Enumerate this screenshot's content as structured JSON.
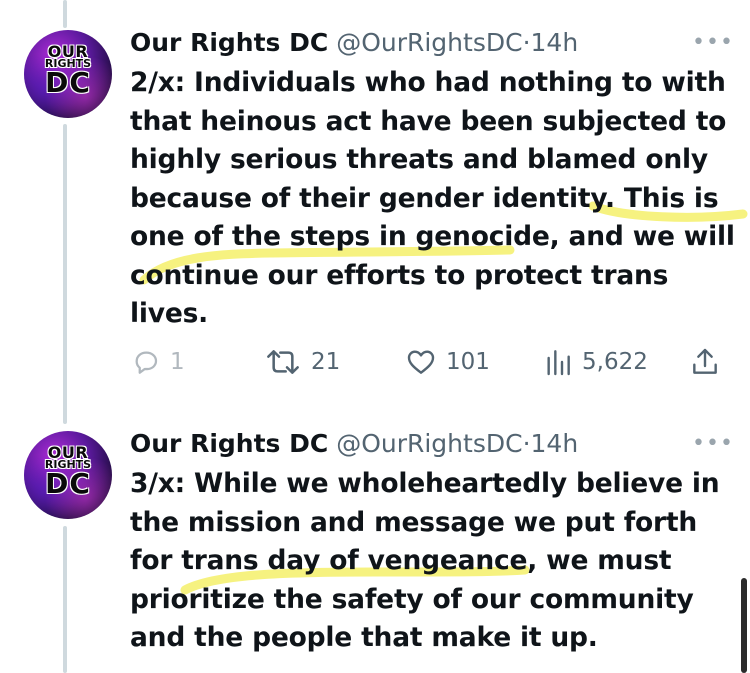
{
  "tweets": [
    {
      "avatar": {
        "line1": "OUR",
        "line2": "RIGHTS",
        "line3": "DC"
      },
      "name": "Our Rights DC",
      "handle": "@OurRightsDC",
      "separator": "·",
      "time": "14h",
      "more": "•••",
      "lines": [
        "2/x: Individuals who had nothing to with",
        "that heinous act have been subjected to",
        "highly serious threats and blamed only",
        "because of their gender identity. This is",
        "one of the steps in genocide, and we will",
        "continue our efforts to protect trans",
        "lives."
      ],
      "actions": {
        "replies": "1",
        "retweets": "21",
        "likes": "101",
        "views": "5,622"
      }
    },
    {
      "avatar": {
        "line1": "OUR",
        "line2": "RIGHTS",
        "line3": "DC"
      },
      "name": "Our Rights DC",
      "handle": "@OurRightsDC",
      "separator": "·",
      "time": "14h",
      "more": "•••",
      "lines": [
        "3/x: While we wholeheartedly believe in",
        "the mission and message we put forth",
        "for trans day of vengeance, we must",
        "prioritize the safety of our community",
        "and the people that make it up."
      ]
    }
  ],
  "colors": {
    "text": "#0f1419",
    "secondary": "#536471",
    "thread_line": "#cfd9de",
    "highlighter": "#f4f06a"
  }
}
